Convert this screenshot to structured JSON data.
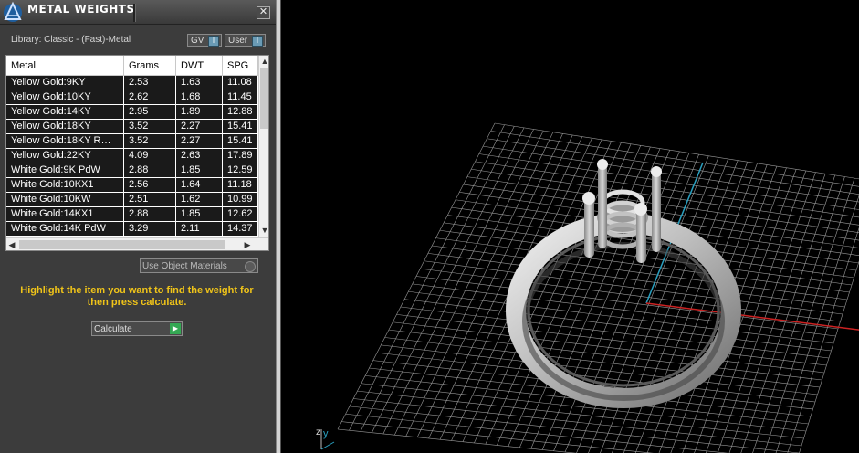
{
  "panel": {
    "title": "METAL WEIGHTS",
    "close_label": "✕",
    "library_label": "Library: Classic - (Fast)-Metal",
    "toggles": [
      {
        "label": "GV",
        "icon": "toggle-icon"
      },
      {
        "label": "User",
        "icon": "toggle-icon"
      }
    ],
    "table": {
      "columns": [
        "Metal",
        "Grams",
        "DWT",
        "SPG"
      ],
      "rows": [
        [
          "Yellow Gold:9KY",
          "2.53",
          "1.63",
          "11.08"
        ],
        [
          "Yellow Gold:10KY",
          "2.62",
          "1.68",
          "11.45"
        ],
        [
          "Yellow Gold:14KY",
          "2.95",
          "1.89",
          "12.88"
        ],
        [
          "Yellow Gold:18KY",
          "3.52",
          "2.27",
          "15.41"
        ],
        [
          "Yellow Gold:18KY R…",
          "3.52",
          "2.27",
          "15.41"
        ],
        [
          "Yellow Gold:22KY",
          "4.09",
          "2.63",
          "17.89"
        ],
        [
          "White Gold:9K PdW",
          "2.88",
          "1.85",
          "12.59"
        ],
        [
          "White Gold:10KX1",
          "2.56",
          "1.64",
          "11.18"
        ],
        [
          "White Gold:10KW",
          "2.51",
          "1.62",
          "10.99"
        ],
        [
          "White Gold:14KX1",
          "2.88",
          "1.85",
          "12.62"
        ],
        [
          "White Gold:14K PdW",
          "3.29",
          "2.11",
          "14.37"
        ]
      ]
    },
    "use_object_materials_label": "Use Object Materials",
    "hint": "Highlight the item you want to find the weight for then press calculate.",
    "calculate_label": "Calculate"
  },
  "viewport": {
    "axis_labels": {
      "z": "z",
      "y": "y"
    },
    "colors": {
      "grid": "#9a9a9a",
      "x_axis": "#cc2222",
      "y_axis": "#2aa0c0",
      "ring": "#c8c8c8",
      "hint": "#f0c419"
    }
  }
}
